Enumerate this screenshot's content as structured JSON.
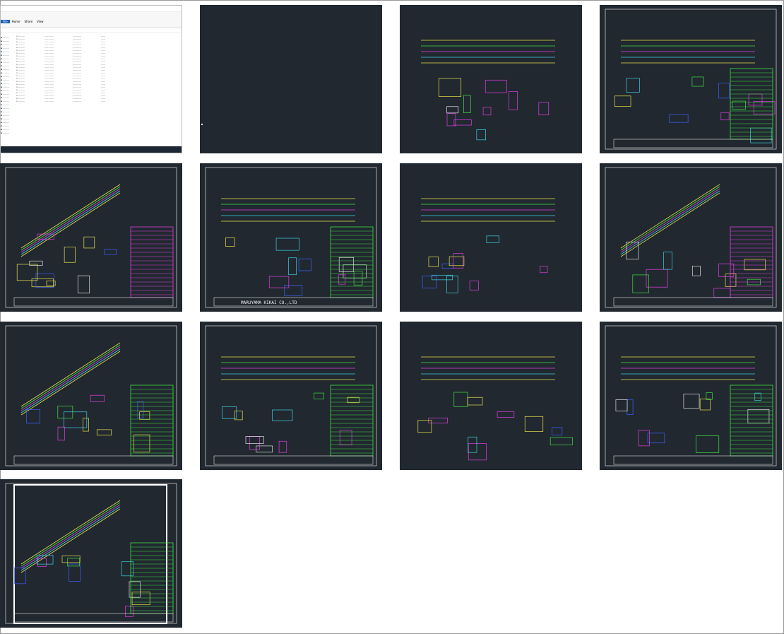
{
  "colors": {
    "cad_background": "#212830",
    "line_yellow": "#e8e04a",
    "line_green": "#40e040",
    "line_magenta": "#e040e0",
    "line_cyan": "#40d0e0",
    "line_white": "#e0e0e0",
    "line_blue": "#4060ff"
  },
  "explorer": {
    "tabs": [
      "File",
      "Home",
      "Share",
      "View"
    ],
    "rows": 24
  },
  "thumbnails": [
    {
      "kind": "file-explorer"
    },
    {
      "kind": "blank-drawing"
    },
    {
      "kind": "conveyor-front-side-views"
    },
    {
      "kind": "drawing-sheet-set"
    },
    {
      "kind": "inclined-conveyor-assembly"
    },
    {
      "kind": "belt-conveyor-drawing"
    },
    {
      "kind": "small-drawing-sheets"
    },
    {
      "kind": "inclined-conveyor-assembly"
    },
    {
      "kind": "inclined-conveyor-outline"
    },
    {
      "kind": "conveyor-plan-with-parts-list"
    },
    {
      "kind": "small-drawing-sheets"
    },
    {
      "kind": "long-conveyor-drawing"
    },
    {
      "kind": "inclined-conveyor-framed"
    }
  ],
  "title_block": {
    "company": "MARUYAMA KIKAI CO.,LTD"
  }
}
